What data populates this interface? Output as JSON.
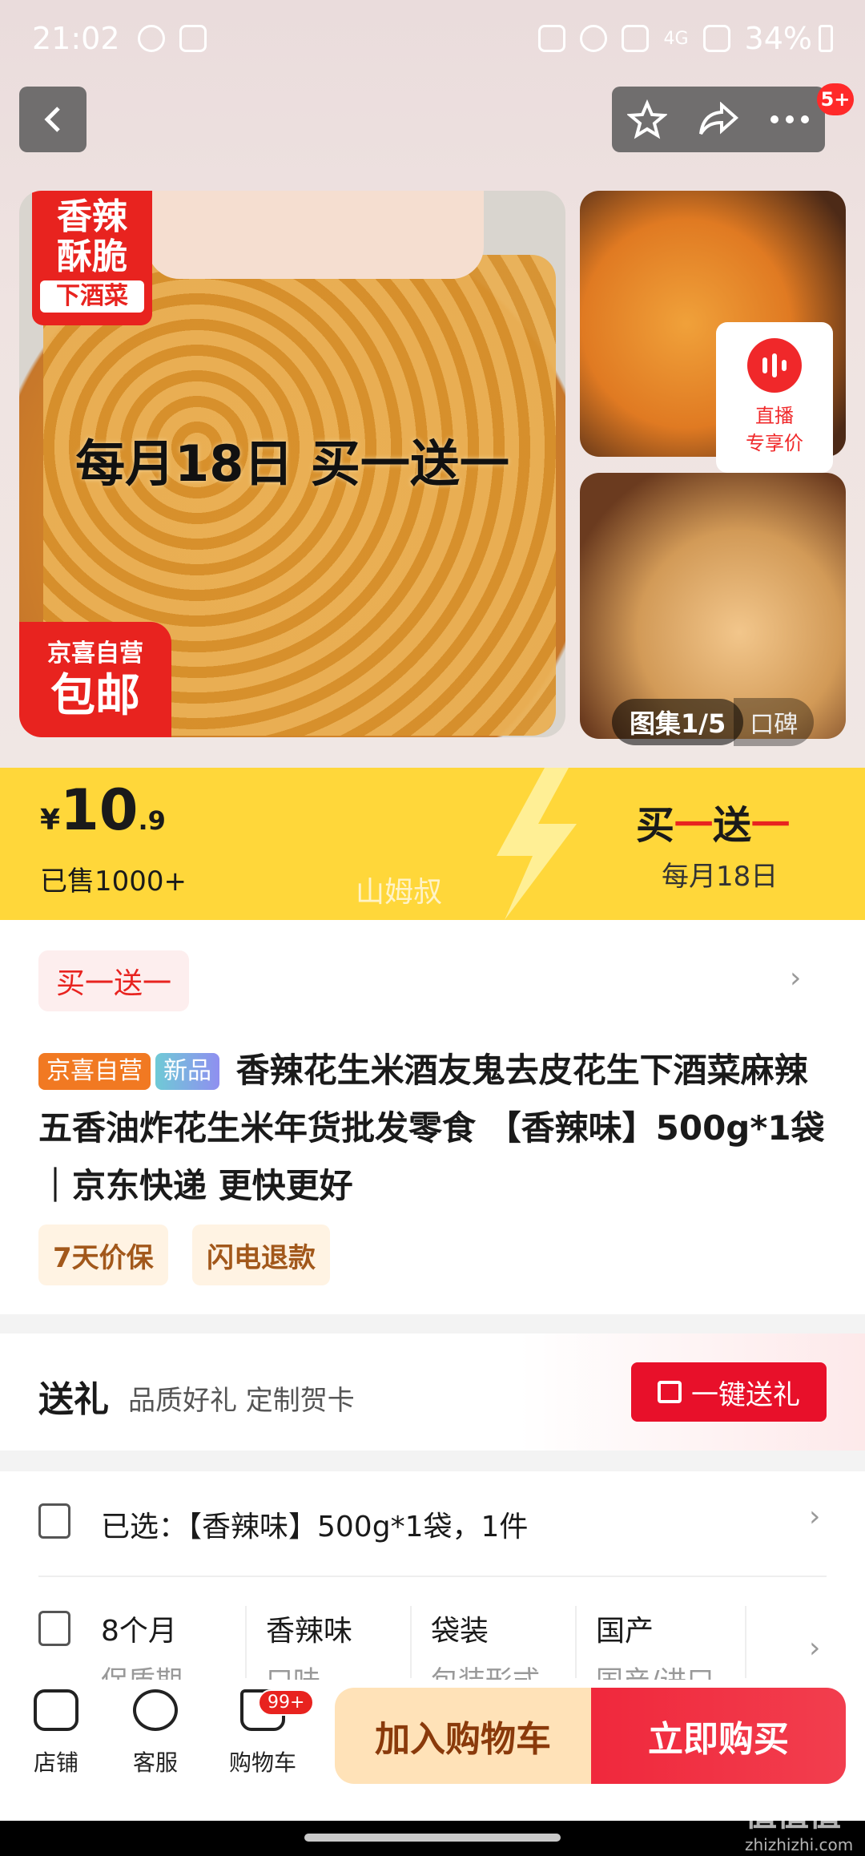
{
  "status_bar": {
    "time": "21:02",
    "network": "4G",
    "battery": "34%"
  },
  "header": {
    "badge": "5+"
  },
  "gallery": {
    "main_tag_top": "香辣酥脆",
    "main_tag_bottom": "下酒菜",
    "main_promo": "每月18日 买一送一",
    "main_ship_top": "京喜自营",
    "main_ship_bottom": "包邮",
    "live_label_line1": "直播",
    "live_label_line2": "专享价",
    "tab_active": "图集1/5",
    "tab_other": "口碑"
  },
  "price_bar": {
    "currency": "¥",
    "price_int": "10",
    "price_dec": ".9",
    "sold": "已售1000+",
    "seller_mark": "山姆叔",
    "promo_prefix": "买",
    "promo_dash1": "一",
    "promo_mid": "送",
    "promo_dash2": "一",
    "promo_date": "每月18日"
  },
  "product": {
    "promo_chip": "买一送一",
    "badge_self": "京喜自营",
    "badge_new": "新品",
    "title": "香辣花生米酒友鬼去皮花生下酒菜麻辣五香油炸花生米年货批发零食 【香辣味】500g*1袋｜京东快递 更快更好",
    "services": [
      "7天价保",
      "闪电退款"
    ]
  },
  "gift": {
    "title": "送礼",
    "subtitle": "品质好礼 定制贺卡",
    "button": "一键送礼"
  },
  "selection": {
    "text": "已选：【香辣味】500g*1袋，1件"
  },
  "specs": [
    {
      "value": "8个月",
      "label": "保质期"
    },
    {
      "value": "香辣味",
      "label": "口味"
    },
    {
      "value": "袋装",
      "label": "包装形式"
    },
    {
      "value": "国产",
      "label": "国产/进口"
    }
  ],
  "bottom_bar": {
    "store": "店铺",
    "service": "客服",
    "cart": "购物车",
    "cart_badge": "99+",
    "add_to_cart": "加入购物车",
    "buy_now": "立即购买"
  },
  "watermark": {
    "main": "值值值",
    "sub": "zhizhizhi.com"
  },
  "colors": {
    "accent_red": "#e8231f",
    "price_yellow": "#ffd73a",
    "cart_btn_bg": "#ffe2b8"
  }
}
